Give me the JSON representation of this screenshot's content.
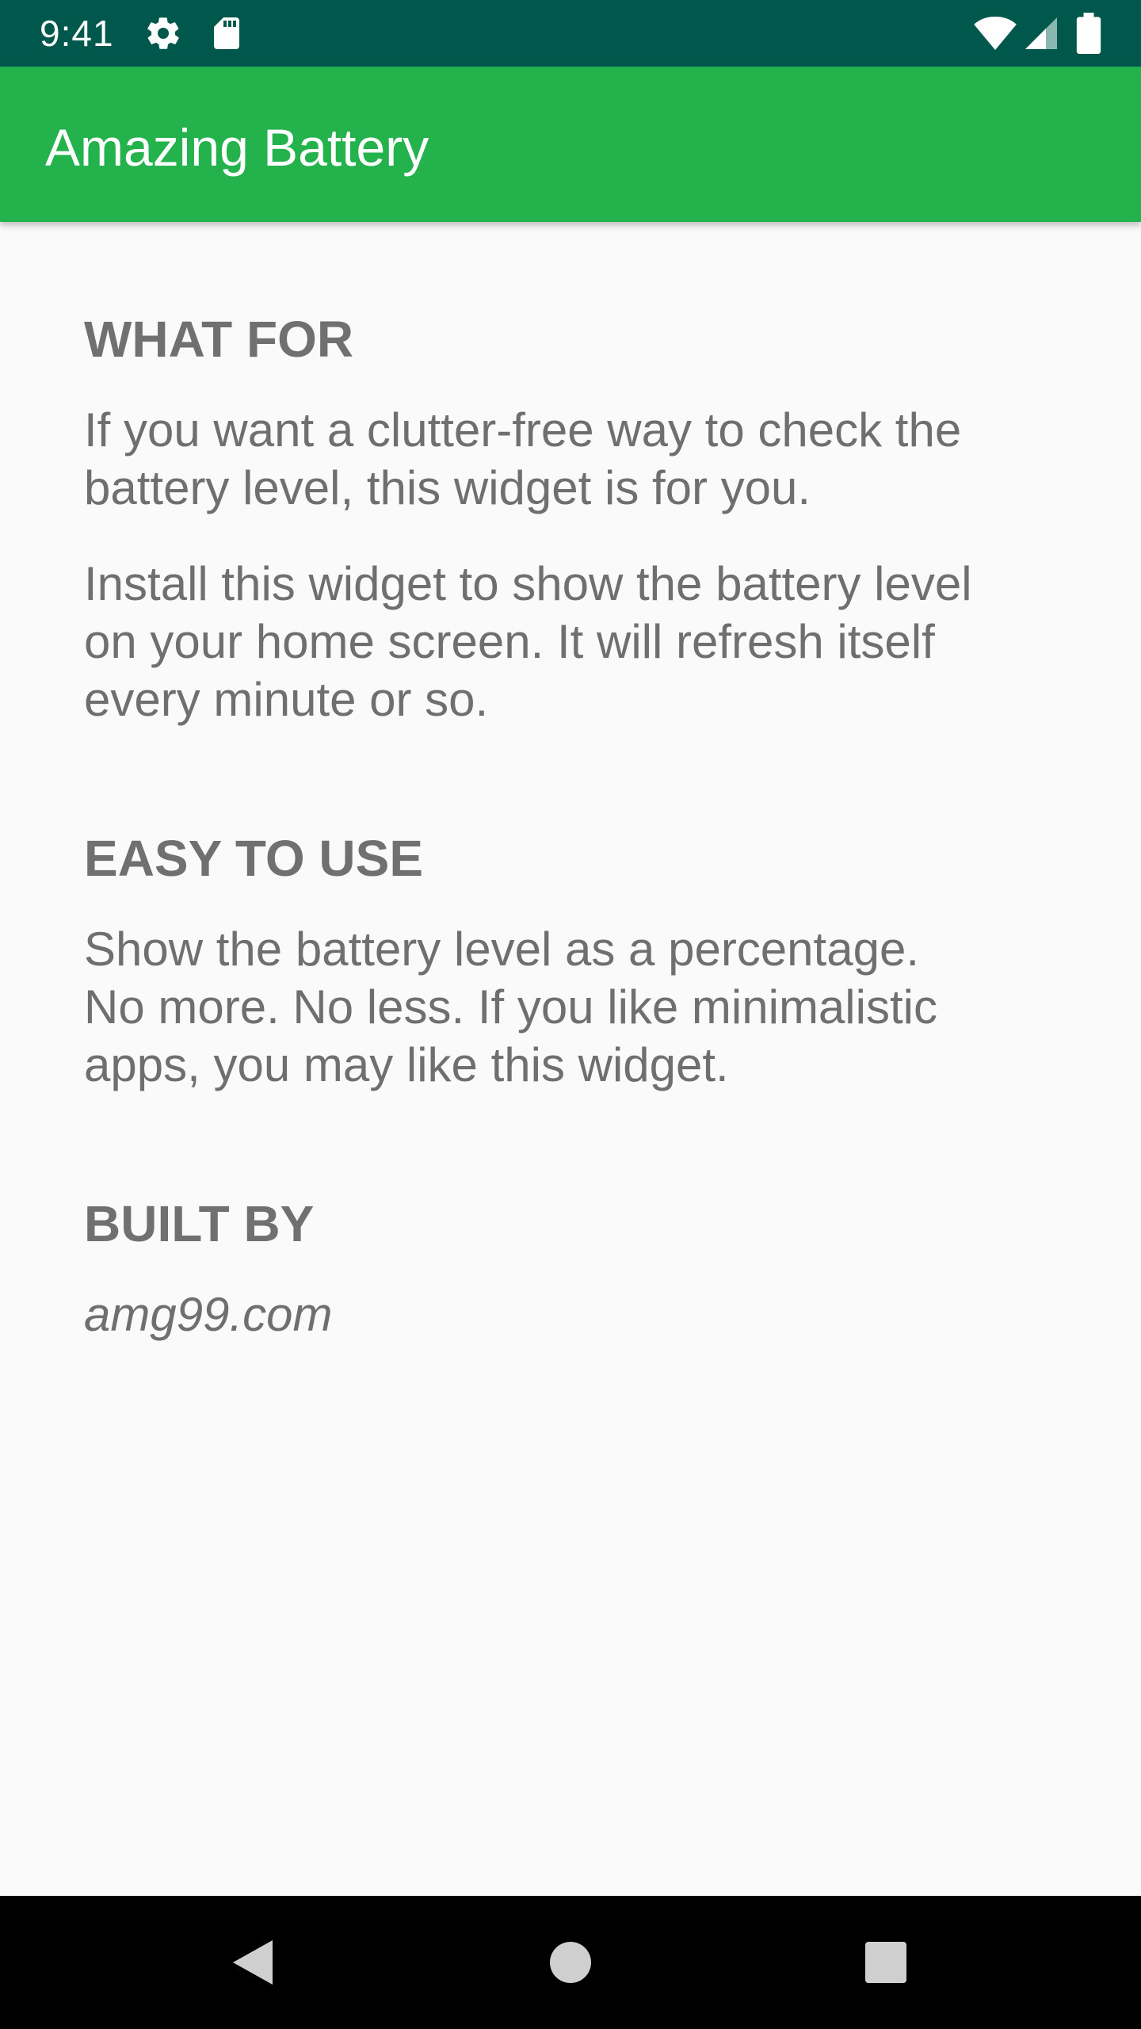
{
  "status_bar": {
    "time": "9:41",
    "icons": [
      "gear-icon",
      "sd-card-icon",
      "wifi-icon",
      "cellular-signal-icon",
      "battery-icon"
    ],
    "background": "#00574b"
  },
  "app_bar": {
    "title": "Amazing Battery",
    "background": "#24b24c"
  },
  "sections": [
    {
      "heading": "WHAT FOR",
      "paragraphs": [
        "If you want a clutter-free way to check the\nbattery level, this widget is for you.",
        "Install this widget to show the battery level\non your home screen.  It will refresh itself\nevery minute or so."
      ]
    },
    {
      "heading": "EASY TO USE",
      "paragraphs": [
        "Show the battery level as a percentage.\nNo more.  No less.  If you like minimalistic\napps, you may like this widget."
      ]
    },
    {
      "heading": "BUILT BY",
      "link": "amg99.com"
    }
  ],
  "nav_bar": {
    "buttons": [
      "back-icon",
      "home-icon",
      "recents-icon"
    ]
  }
}
